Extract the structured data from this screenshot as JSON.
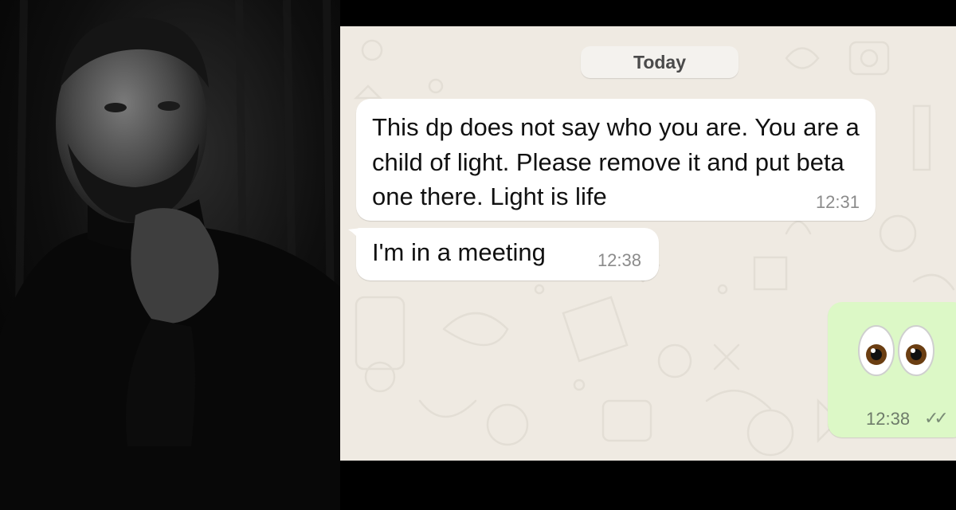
{
  "chat": {
    "date_divider": "Today",
    "messages": [
      {
        "direction": "incoming",
        "text": "This dp does not say who you are. You are a child of light. Please remove it and put beta one there. Light is life",
        "time": "12:31"
      },
      {
        "direction": "incoming",
        "text": "I'm in a meeting",
        "time": "12:38"
      },
      {
        "direction": "outgoing",
        "emoji": "eyes",
        "time": "12:38",
        "ticks": "✓✓"
      }
    ],
    "colors": {
      "background": "#efeae2",
      "incoming_bubble": "#ffffff",
      "outgoing_bubble": "#dcf8c6"
    }
  },
  "photo": {
    "description_icon": "portrait-photo"
  }
}
